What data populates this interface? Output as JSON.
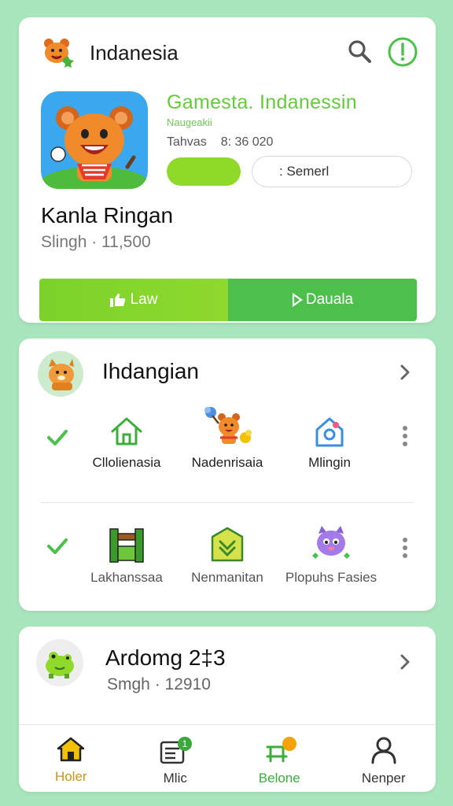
{
  "header": {
    "title": "Indanesia",
    "icons": [
      "mascot-logo-icon",
      "search-icon",
      "info-icon"
    ]
  },
  "app": {
    "name": "Gamesta. Indanessin",
    "developer": "Naugeakii",
    "meta_label": "Tahvas",
    "meta_value": "8: 36 020",
    "outline_button": ": Semerl",
    "game_title": "Kanla Ringan",
    "game_subtitle": "Slingh · 11,500",
    "primary_button": "Law",
    "secondary_button": "Dauala"
  },
  "category": {
    "title": "Ihdangian",
    "row1": [
      {
        "label": "Cllolienasia",
        "icon": "home-icon"
      },
      {
        "label": "Nadenrisaia",
        "icon": "mascot-cheer-icon"
      },
      {
        "label": "Mlingin",
        "icon": "house-badge-icon"
      }
    ],
    "row2": [
      {
        "label": "Lakhanssaa",
        "icon": "fence-icon"
      },
      {
        "label": "Nenmanitan",
        "icon": "chevron-badge-icon"
      },
      {
        "label": "Plopuhs Fasies",
        "icon": "monster-icon"
      }
    ]
  },
  "featured": {
    "title": "Ardomg 2‡3",
    "subtitle": "Smgh · 12910"
  },
  "bottom_nav": [
    {
      "label": "Holer",
      "icon": "home-icon",
      "badge": ""
    },
    {
      "label": "Mlic",
      "icon": "news-icon",
      "badge": "1"
    },
    {
      "label": "Belone",
      "icon": "store-icon",
      "badge": ""
    },
    {
      "label": "Nenper",
      "icon": "profile-icon",
      "badge": ""
    }
  ],
  "colors": {
    "background": "#a9e6bd",
    "accent_green": "#4cc04a",
    "lime": "#8ed92a",
    "title_green": "#63cc3a",
    "home_gold": "#f2c200"
  }
}
